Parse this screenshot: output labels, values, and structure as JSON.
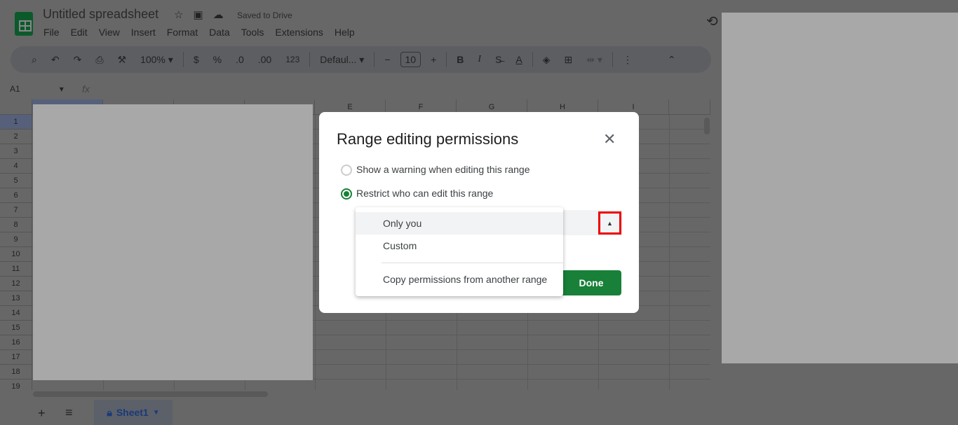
{
  "app": {
    "title": "Untitled spreadsheet",
    "saved_status": "Saved to Drive"
  },
  "menu": [
    "File",
    "Edit",
    "View",
    "Insert",
    "Format",
    "Data",
    "Tools",
    "Extensions",
    "Help"
  ],
  "toolbar": {
    "zoom": "100%",
    "currency": "$",
    "percent": "%",
    "dec_decrease": ".0",
    "dec_increase": ".00",
    "number_format": "123",
    "font": "Defaul...",
    "font_size": "10",
    "bold": "B",
    "italic": "I"
  },
  "formula_bar": {
    "cell_ref": "A1",
    "fx": "fx"
  },
  "columns": [
    "",
    "",
    "",
    "",
    "E",
    "F",
    "G",
    "H",
    "I",
    ""
  ],
  "rows": [
    "1",
    "2",
    "3",
    "4",
    "5",
    "6",
    "7",
    "8",
    "9",
    "10",
    "11",
    "12",
    "13",
    "14",
    "15",
    "16",
    "17",
    "18",
    "19"
  ],
  "dialog": {
    "title": "Range editing permissions",
    "options": [
      {
        "label": "Show a warning when editing this range",
        "selected": false
      },
      {
        "label": "Restrict who can edit this range",
        "selected": true
      }
    ],
    "dropdown": [
      "Only you",
      "Custom",
      "Copy permissions from another range"
    ],
    "done_label": "Done"
  },
  "sheets": [
    {
      "name": "Sheet1",
      "locked": true
    }
  ],
  "colors": {
    "accent": "#188038",
    "highlight": "#ee0000"
  }
}
